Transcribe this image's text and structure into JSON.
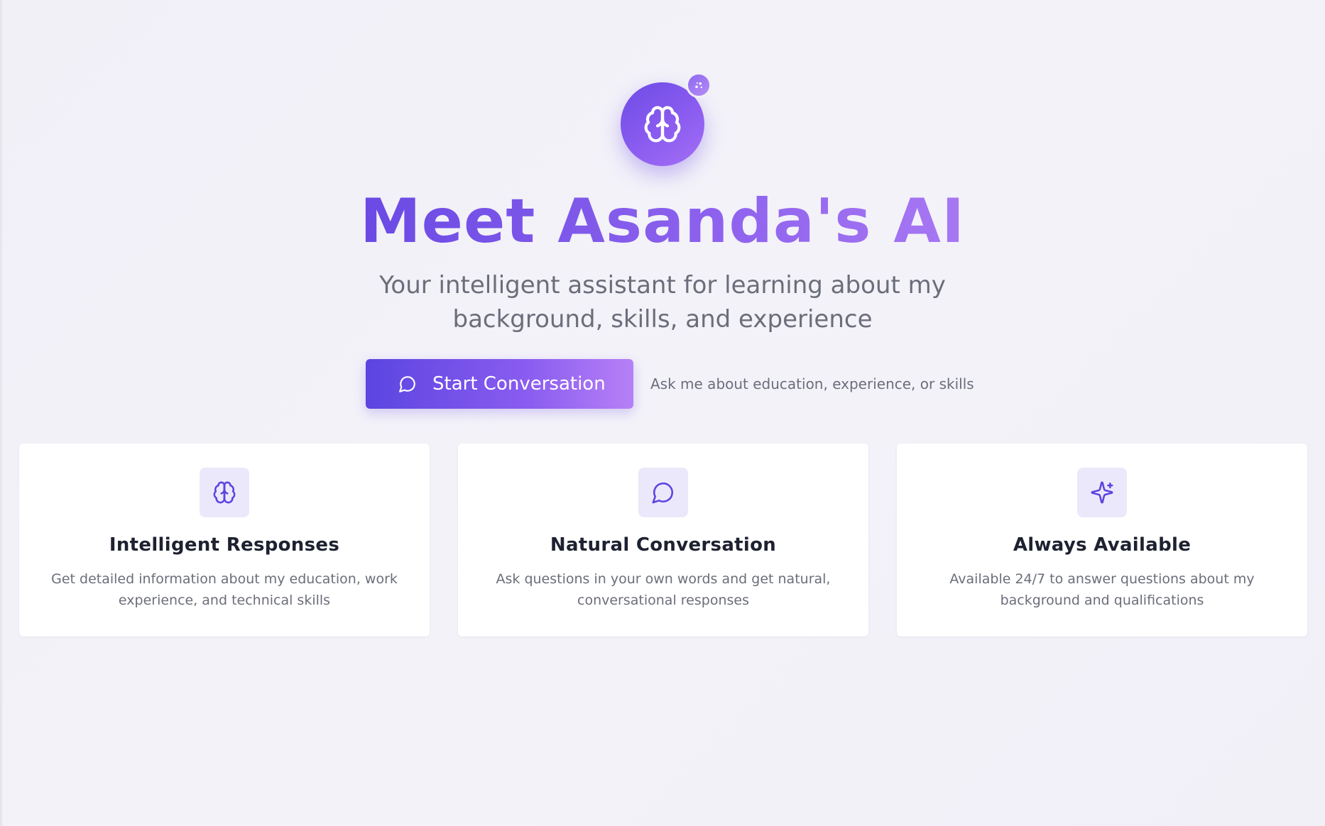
{
  "hero": {
    "logo_icon": "brain-icon",
    "badge_icon": "sparkle-icon",
    "title": "Meet Asanda's AI",
    "subtitle": "Your intelligent assistant for learning about my background, skills, and experience",
    "cta_label": "Start Conversation",
    "cta_icon": "chat-bubble-icon",
    "cta_hint": "Ask me about education, experience, or skills"
  },
  "features": [
    {
      "icon": "brain-icon",
      "title": "Intelligent Responses",
      "description": "Get detailed information about my education, work experience, and technical skills"
    },
    {
      "icon": "chat-bubble-icon",
      "title": "Natural Conversation",
      "description": "Ask questions in your own words and get natural, conversational responses"
    },
    {
      "icon": "sparkles-icon",
      "title": "Always Available",
      "description": "Available 24/7 to answer questions about my background and qualifications"
    }
  ],
  "colors": {
    "accent": "#6d4be6",
    "accent_light": "#b680f6",
    "background": "#f1f0f7",
    "card_icon_bg": "#ece8fb",
    "muted_text": "#6b6e7a"
  }
}
